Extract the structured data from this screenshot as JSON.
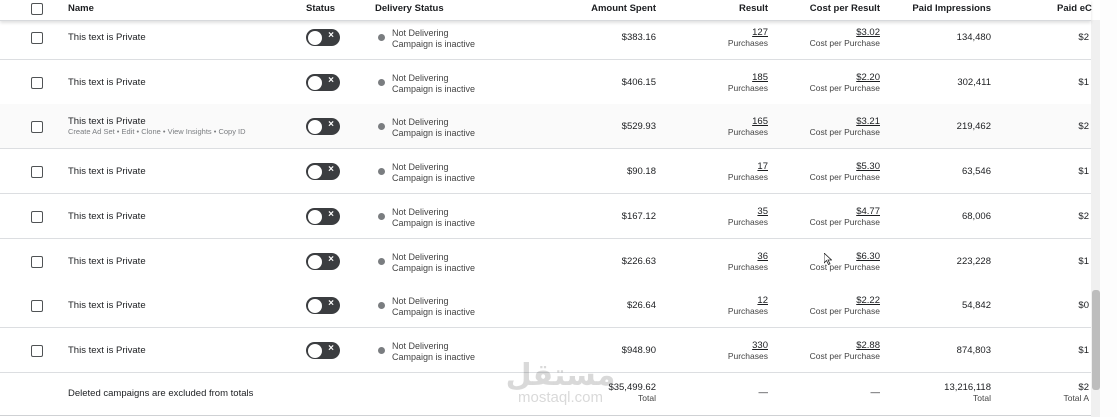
{
  "columns": {
    "name": "Name",
    "status": "Status",
    "delivery_status": "Delivery Status",
    "amount_spent": "Amount Spent",
    "result": "Result",
    "cost_per_result": "Cost per Result",
    "paid_impressions": "Paid Impressions",
    "paid_ecpm": "Paid eC"
  },
  "rows": [
    {
      "name": "This text is Private",
      "delivery": "Not Delivering",
      "delivery_sub": "Campaign is inactive",
      "amount": "$383.16",
      "result": "127",
      "result_sub": "Purchases",
      "cpr": "$3.02",
      "cpr_sub": "Cost per Purchase",
      "impressions": "134,480",
      "ecpm": "$2"
    },
    {
      "name": "This text is Private",
      "delivery": "Not Delivering",
      "delivery_sub": "Campaign is inactive",
      "amount": "$406.15",
      "result": "185",
      "result_sub": "Purchases",
      "cpr": "$2.20",
      "cpr_sub": "Cost per Purchase",
      "impressions": "302,411",
      "ecpm": "$1"
    },
    {
      "name": "This text is Private",
      "actions": "Create Ad Set  •  Edit  •  Clone  •  View Insights  •  Copy ID",
      "delivery": "Not Delivering",
      "delivery_sub": "Campaign is inactive",
      "amount": "$529.93",
      "result": "165",
      "result_sub": "Purchases",
      "cpr": "$3.21",
      "cpr_sub": "Cost per Purchase",
      "impressions": "219,462",
      "ecpm": "$2"
    },
    {
      "name": "This text is Private",
      "delivery": "Not Delivering",
      "delivery_sub": "Campaign is inactive",
      "amount": "$90.18",
      "result": "17",
      "result_sub": "Purchases",
      "cpr": "$5.30",
      "cpr_sub": "Cost per Purchase",
      "impressions": "63,546",
      "ecpm": "$1"
    },
    {
      "name": "This text is Private",
      "delivery": "Not Delivering",
      "delivery_sub": "Campaign is inactive",
      "amount": "$167.12",
      "result": "35",
      "result_sub": "Purchases",
      "cpr": "$4.77",
      "cpr_sub": "Cost per Purchase",
      "impressions": "68,006",
      "ecpm": "$2"
    },
    {
      "name": "This text is Private",
      "delivery": "Not Delivering",
      "delivery_sub": "Campaign is inactive",
      "amount": "$226.63",
      "result": "36",
      "result_sub": "Purchases",
      "cpr": "$6.30",
      "cpr_sub": "Cost per Purchase",
      "impressions": "223,228",
      "ecpm": "$1"
    },
    {
      "name": "This text is Private",
      "delivery": "Not Delivering",
      "delivery_sub": "Campaign is inactive",
      "amount": "$26.64",
      "result": "12",
      "result_sub": "Purchases",
      "cpr": "$2.22",
      "cpr_sub": "Cost per Purchase",
      "impressions": "54,842",
      "ecpm": "$0"
    },
    {
      "name": "This text is Private",
      "delivery": "Not Delivering",
      "delivery_sub": "Campaign is inactive",
      "amount": "$948.90",
      "result": "330",
      "result_sub": "Purchases",
      "cpr": "$2.88",
      "cpr_sub": "Cost per Purchase",
      "impressions": "874,803",
      "ecpm": "$1"
    }
  ],
  "totals": {
    "note": "Deleted campaigns are excluded from totals",
    "amount": "$35,499.62",
    "amount_label": "Total",
    "result": "—",
    "cpr": "—",
    "impressions": "13,216,118",
    "impressions_label": "Total",
    "ecpm": "$2",
    "ecpm_label": "Total A"
  },
  "watermark": {
    "arabic": "مستقل",
    "latin": "mostaql.com"
  },
  "colors": {
    "toggle_off": "#3b3d40",
    "status_dot": "#7a7d80",
    "border": "#dcdee1"
  }
}
